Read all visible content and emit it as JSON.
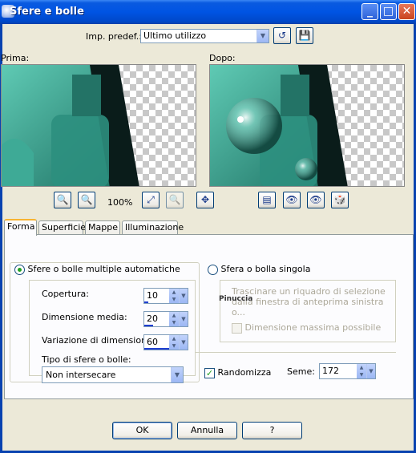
{
  "window": {
    "title": "Sfere e bolle"
  },
  "preset": {
    "label": "Imp. predef.:",
    "value": "Ultimo utilizzo"
  },
  "preview": {
    "before_label": "Prima:",
    "after_label": "Dopo:",
    "zoom": "100%"
  },
  "tabs": [
    {
      "label": "Forma"
    },
    {
      "label": "Superficie"
    },
    {
      "label": "Mappe"
    },
    {
      "label": "Illuminazione"
    }
  ],
  "forma": {
    "auto_radio_label": "Sfere o bolle multiple automatiche",
    "single_radio_label": "Sfera o bolla singola",
    "coverage": {
      "label": "Copertura:",
      "value": "10",
      "fraction": 0.1
    },
    "avg_size": {
      "label": "Dimensione media:",
      "value": "20",
      "fraction": 0.2
    },
    "size_variation": {
      "label": "Variazione di dimensione:",
      "value": "60",
      "fraction": 0.6
    },
    "type": {
      "label": "Tipo di sfere o bolle:",
      "value": "Non intersecare"
    },
    "single_hint": "Trascinare un riquadro di selezione dalla finestra di anteprima sinistra o...",
    "max_size_label": "Dimensione massima possibile",
    "randomize_label": "Randomizza",
    "seed": {
      "label": "Seme:",
      "value": "172"
    }
  },
  "watermark": "Pinuccia",
  "buttons": {
    "ok": "OK",
    "cancel": "Annulla",
    "help": "?"
  },
  "colors": {
    "titlebar": "#0054e3",
    "teal": "#2f9e8a",
    "dialog_bg": "#ece9d8"
  }
}
